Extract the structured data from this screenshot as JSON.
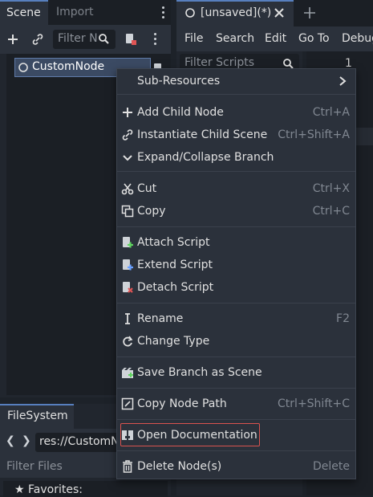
{
  "scene_dock": {
    "tab_scene": "Scene",
    "tab_import": "Import",
    "filter_placeholder": "Filter N",
    "root_node": "CustomNode"
  },
  "editor": {
    "tab_title": "[unsaved](*)",
    "menu": [
      "File",
      "Search",
      "Edit",
      "Go To",
      "Debug"
    ],
    "filter_scripts": "Filter Scripts",
    "line_number": "1"
  },
  "filesystem": {
    "tab_label": "FileSystem",
    "path": "res://CustomN",
    "filter_files": "Filter Files",
    "favorites": "Favorites:"
  },
  "context_menu": {
    "items": [
      {
        "label": "Sub-Resources",
        "shortcut": "",
        "icon": "chevron-right-icon"
      },
      {
        "label": "Add Child Node",
        "shortcut": "Ctrl+A",
        "icon": "plus-icon"
      },
      {
        "label": "Instantiate Child Scene",
        "shortcut": "Ctrl+Shift+A",
        "icon": "link-icon"
      },
      {
        "label": "Expand/Collapse Branch",
        "shortcut": "",
        "icon": "chevron-down-icon"
      },
      {
        "label": "Cut",
        "shortcut": "Ctrl+X",
        "icon": "scissors-icon"
      },
      {
        "label": "Copy",
        "shortcut": "Ctrl+C",
        "icon": "copy-icon"
      },
      {
        "label": "Attach Script",
        "shortcut": "",
        "icon": "attach-script-icon"
      },
      {
        "label": "Extend Script",
        "shortcut": "",
        "icon": "extend-script-icon"
      },
      {
        "label": "Detach Script",
        "shortcut": "",
        "icon": "detach-script-icon"
      },
      {
        "label": "Rename",
        "shortcut": "F2",
        "icon": "rename-icon"
      },
      {
        "label": "Change Type",
        "shortcut": "",
        "icon": "change-type-icon"
      },
      {
        "label": "Save Branch as Scene",
        "shortcut": "",
        "icon": "save-branch-icon"
      },
      {
        "label": "Copy Node Path",
        "shortcut": "Ctrl+Shift+C",
        "icon": "copy-path-icon"
      },
      {
        "label": "Open Documentation",
        "shortcut": "",
        "icon": "documentation-icon"
      },
      {
        "label": "Delete Node(s)",
        "shortcut": "Delete",
        "icon": "trash-icon"
      }
    ]
  },
  "colors": {
    "accent": "#577fbe",
    "highlight_border": "#d9534f",
    "menu_bg": "#2b313b",
    "panel_bg": "#21262e"
  }
}
